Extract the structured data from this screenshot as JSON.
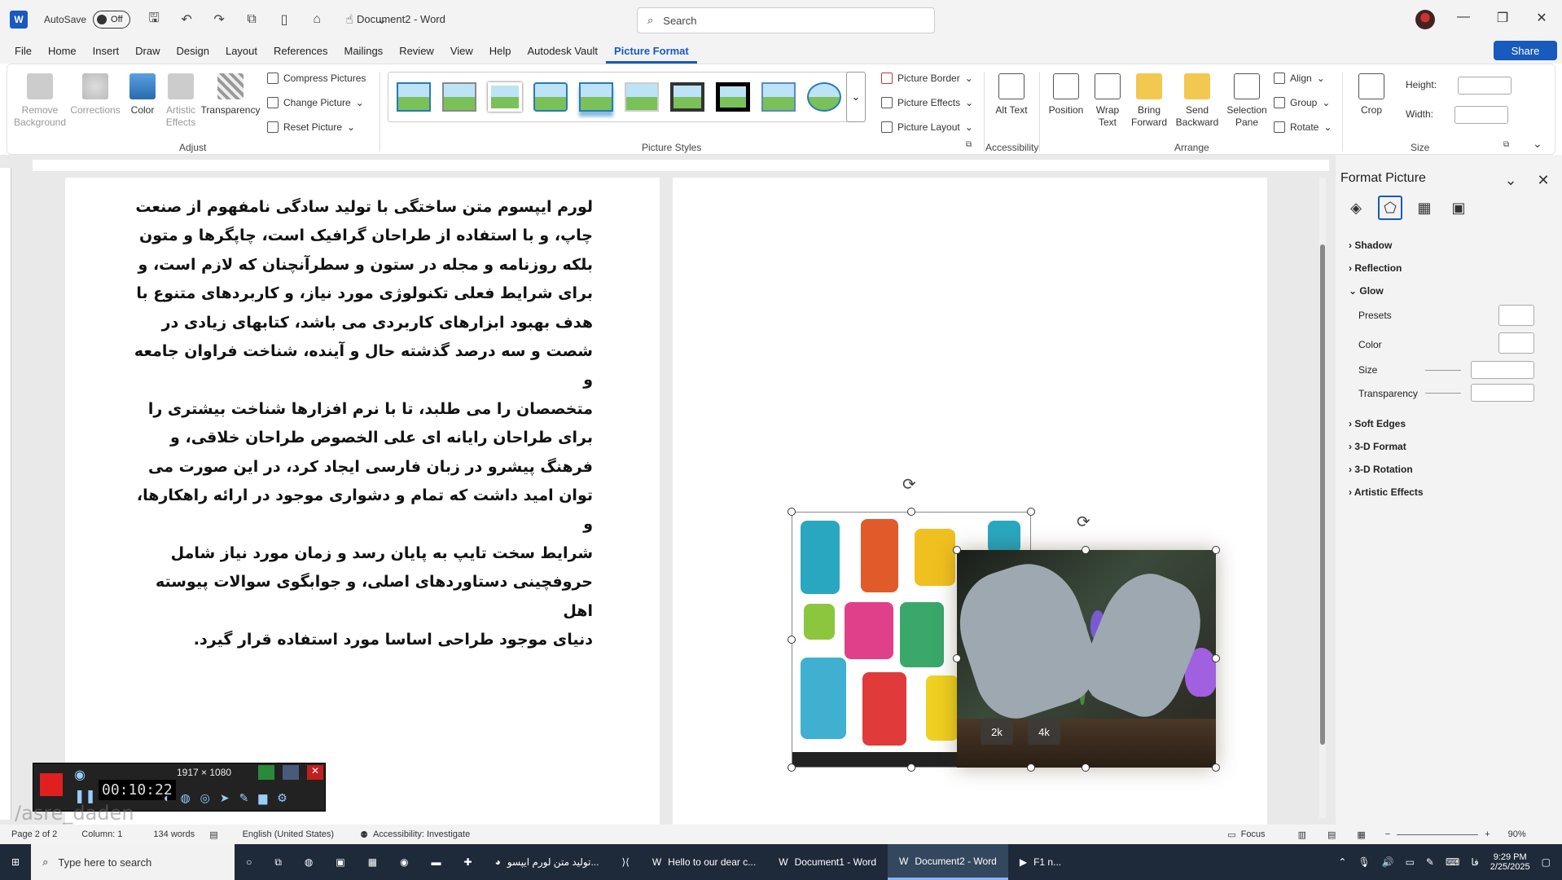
{
  "titlebar": {
    "autosave_label": "AutoSave",
    "toggle_state": "Off",
    "doc_title": "Document2 - Word",
    "search_placeholder": "Search"
  },
  "menu": {
    "items": [
      "File",
      "Home",
      "Insert",
      "Draw",
      "Design",
      "Layout",
      "References",
      "Mailings",
      "Review",
      "View",
      "Help",
      "Autodesk Vault",
      "Picture Format"
    ],
    "active": "Picture Format",
    "share": "Share"
  },
  "ribbon": {
    "adjust": {
      "remove_bg": "Remove Background",
      "corrections": "Corrections",
      "color": "Color",
      "artistic": "Artistic Effects",
      "transparency": "Transparency",
      "compress": "Compress Pictures",
      "change": "Change Picture",
      "reset": "Reset Picture",
      "label": "Adjust"
    },
    "styles": {
      "label": "Picture Styles",
      "border": "Picture Border",
      "effects": "Picture Effects",
      "layout": "Picture Layout"
    },
    "accessibility": {
      "alt_text": "Alt Text",
      "label": "Accessibility"
    },
    "arrange": {
      "position": "Position",
      "wrap": "Wrap Text",
      "bring": "Bring Forward",
      "send": "Send Backward",
      "selection": "Selection Pane",
      "align": "Align",
      "group": "Group",
      "rotate": "Rotate",
      "label": "Arrange"
    },
    "size": {
      "crop": "Crop",
      "height": "Height:",
      "width": "Width:",
      "label": "Size"
    }
  },
  "document": {
    "lines": [
      "لورم ایپسوم متن ساختگی با تولید سادگی نامفهوم از صنعت",
      "چاپ، و با استفاده از طراحان گرافیک است، چاپگرها و متون",
      "بلکه روزنامه و مجله در ستون و سطرآنچنان که لازم است، و",
      "برای شرایط فعلی تکنولوژی مورد نیاز، و کاربردهای متنوع با",
      "هدف بهبود ابزارهای کاربردی می باشد، کتابهای زیادی در",
      "شصت و سه درصد گذشته حال و آینده، شناخت فراوان جامعه و",
      "متخصصان را می طلبد، تا با نرم افزارها شناخت بیشتری را",
      "برای طراحان رایانه ای علی الخصوص طراحان خلاقی، و",
      "فرهنگ پیشرو در زبان فارسی ایجاد کرد، در این صورت می",
      "توان امید داشت که تمام و دشواری موجود در ارائه راهکارها، و",
      "شرایط سخت تایپ به پایان رسد و زمان مورد نیاز شامل",
      "حروفچینی دستاوردهای اصلی، و جوابگوی سوالات پیوسته اهل",
      "دنیای موجود طراحی اساسا مورد استفاده قرار گیرد."
    ],
    "badge_2k": "2k",
    "badge_4k": "4k"
  },
  "pane": {
    "title": "Format Picture",
    "sections_top": [
      "Shadow",
      "Reflection",
      "Glow"
    ],
    "glow_rows": [
      "Presets",
      "Color",
      "Size",
      "Transparency"
    ],
    "sections_bottom": [
      "Soft Edges",
      "3-D Format",
      "3-D Rotation",
      "Artistic Effects"
    ]
  },
  "recorder": {
    "dimensions": "1917 × 1080",
    "timer": "00:10:22"
  },
  "status": {
    "page": "Page 2 of 2",
    "column": "Column: 1",
    "words": "134 words",
    "language": "English (United States)",
    "accessibility": "Accessibility: Investigate",
    "focus": "Focus",
    "zoom": "90%"
  },
  "taskbar": {
    "search": "Type here to search",
    "apps": [
      "تولید متن لورم ایپسو...",
      "Hello to our dear c...",
      "Document1 - Word",
      "Document2 - Word",
      "F1 n..."
    ],
    "time": "9:29 PM",
    "date": "2/25/2025",
    "lang": "فا"
  },
  "watermark": "/asre_daden",
  "colors": {
    "accent": "#185abd",
    "record": "#e02020"
  }
}
